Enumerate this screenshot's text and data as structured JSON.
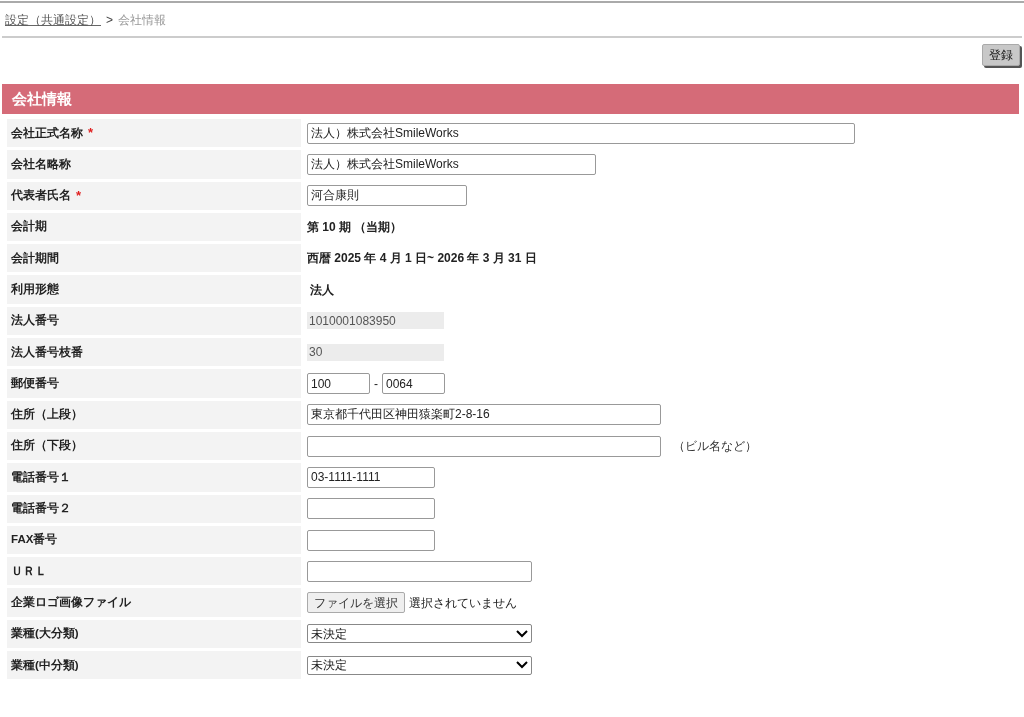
{
  "breadcrumb": {
    "link": "設定（共通設定）",
    "separator": ">",
    "current": "会社情報"
  },
  "register_button": "登録",
  "required_mark": "*",
  "section": {
    "title": "会社情報"
  },
  "rows": [
    {
      "label": "会社正式名称",
      "required": true,
      "kind": "input",
      "value": "法人）株式会社SmileWorks"
    },
    {
      "label": "会社名略称",
      "required": false,
      "kind": "input",
      "value": "法人）株式会社SmileWorks"
    },
    {
      "label": "代表者氏名",
      "required": true,
      "kind": "input",
      "value": "河合康則"
    },
    {
      "label": "会計期",
      "required": false,
      "kind": "text",
      "value": "第 10 期 （当期）"
    },
    {
      "label": "会計期間",
      "required": false,
      "kind": "text",
      "value": "西暦 2025 年 4 月 1 日~ 2026 年 3 月 31 日"
    },
    {
      "label": "利用形態",
      "required": false,
      "kind": "text",
      "value": " 法人"
    },
    {
      "label": "法人番号",
      "required": false,
      "kind": "readonly",
      "value": "1010001083950"
    },
    {
      "label": "法人番号枝番",
      "required": false,
      "kind": "readonly",
      "value": "30"
    },
    {
      "label": "郵便番号",
      "required": false,
      "kind": "postal",
      "value": "100",
      "value2": "0064",
      "separator": "-"
    },
    {
      "label": "住所（上段）",
      "required": false,
      "kind": "input",
      "value": "東京都千代田区神田猿楽町2-8-16"
    },
    {
      "label": "住所（下段）",
      "required": false,
      "kind": "input",
      "value": "",
      "note": "（ビル名など）"
    },
    {
      "label": "電話番号１",
      "required": false,
      "kind": "input",
      "value": "03-1111-1111"
    },
    {
      "label": "電話番号２",
      "required": false,
      "kind": "input",
      "value": ""
    },
    {
      "label": "FAX番号",
      "required": false,
      "kind": "input",
      "value": ""
    },
    {
      "label": "ＵＲＬ",
      "required": false,
      "kind": "input",
      "value": ""
    },
    {
      "label": "企業ロゴ画像ファイル",
      "required": false,
      "kind": "file",
      "button": "ファイルを選択",
      "status": "選択されていません"
    },
    {
      "label": "業種(大分類)",
      "required": false,
      "kind": "select",
      "value": "未決定"
    },
    {
      "label": "業種(中分類)",
      "required": false,
      "kind": "select",
      "value": "未決定"
    }
  ]
}
